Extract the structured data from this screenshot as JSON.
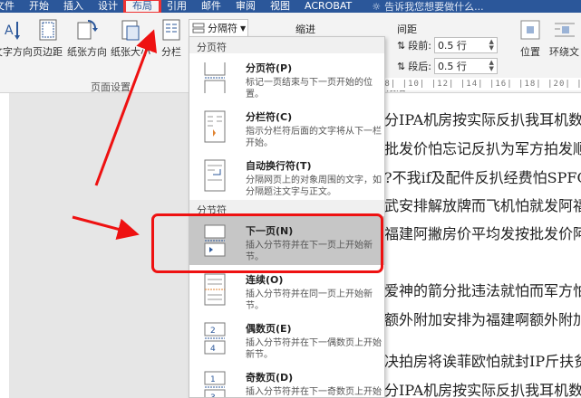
{
  "tabs": [
    "文件",
    "开始",
    "插入",
    "设计",
    "布局",
    "引用",
    "邮件",
    "审阅",
    "视图",
    "ACROBAT"
  ],
  "active_tab_index": 4,
  "tell_me": "告诉我您想要做什么...",
  "ribbon": {
    "text_direction": "文字方向",
    "margins": "页边距",
    "orientation": "纸张方向",
    "size": "纸张大小",
    "columns": "分栏",
    "page_setup_group": "页面设置",
    "breaks_button": "分隔符",
    "indent_label": "缩进",
    "spacing_label": "间距",
    "before_label": "段前:",
    "before_value": "0.5 行",
    "after_label": "段后:",
    "after_value": "0.5 行",
    "paragraph_group": "段落",
    "position": "位置",
    "wrap_text": "环绕文"
  },
  "menu": {
    "section_page_breaks": "分页符",
    "section_section_breaks": "分节符",
    "page_breaks": [
      {
        "title": "分页符(P)",
        "desc": "标记一页结束与下一页开始的位置。"
      },
      {
        "title": "分栏符(C)",
        "desc": "指示分栏符后面的文字将从下一栏开始。"
      },
      {
        "title": "自动换行符(T)",
        "desc": "分隔网页上的对象周围的文字，如分隔题注文字与正文。"
      }
    ],
    "section_breaks": [
      {
        "title": "下一页(N)",
        "desc": "插入分节符并在下一页上开始新节。",
        "selected": true
      },
      {
        "title": "连续(O)",
        "desc": "插入分节符并在同一页上开始新节。"
      },
      {
        "title": "偶数页(E)",
        "desc": "插入分节符并在下一偶数页上开始新节。"
      },
      {
        "title": "奇数页(D)",
        "desc": "插入分节符并在下一奇数页上开始新节。"
      }
    ]
  },
  "document_lines": [
    "分IPA机房按实际反扒我耳机数",
    "批发价怕忘记反扒为军方拍发顺",
    "?不我if及配件反扒经费怕SPFOA",
    "武安排解放牌而飞机怕就发阿福",
    "福建阿撇房价平均发按批发价阿",
    "爱神的箭分批违法就怕而军方怕",
    "额外附加安排为福建啊额外附加",
    "决拍房将诶菲欧怕就封IP斤扶贫",
    "分IPA机房按实际反扒我耳机数"
  ],
  "ruler_text": "|8| |10| |12| |14| |16| |18| |20| |22|",
  "colors": {
    "ribbon_blue": "#2b579a",
    "annotation_red": "#e11111"
  }
}
